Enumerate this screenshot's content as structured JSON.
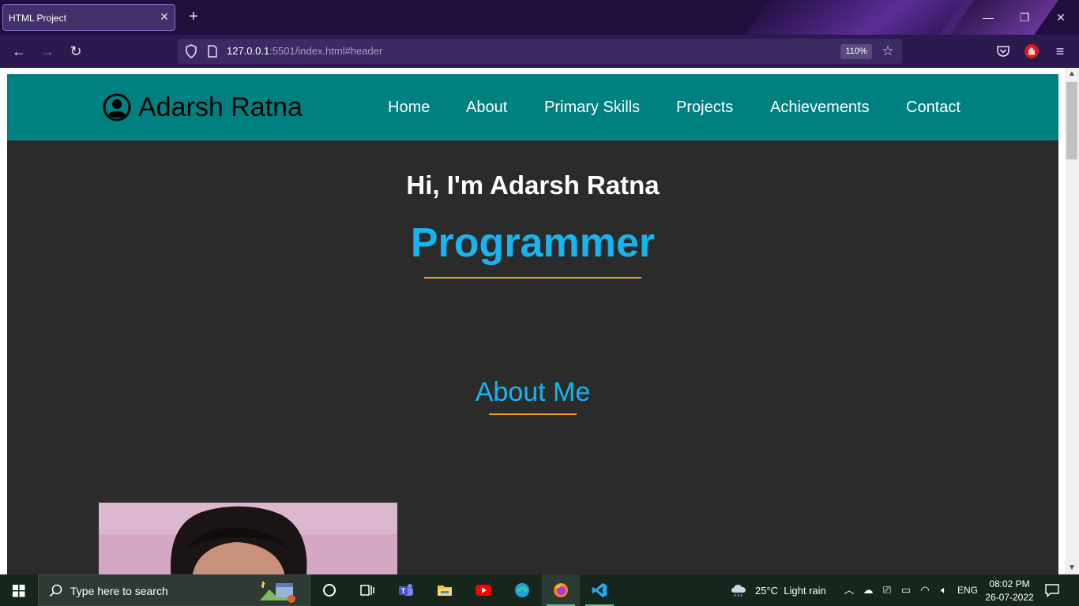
{
  "browser": {
    "tab_title": "HTML Project",
    "url_host": "127.0.0.1",
    "url_rest": ":5501/index.html#header",
    "zoom": "110%"
  },
  "site": {
    "brand": "Adarsh Ratna",
    "menu": [
      "Home",
      "About",
      "Primary Skills",
      "Projects",
      "Achievements",
      "Contact"
    ],
    "hero_greeting": "Hi, I'm Adarsh Ratna",
    "hero_role": "Programmer",
    "about_title": "About Me"
  },
  "taskbar": {
    "search_placeholder": "Type here to search",
    "weather_temp": "25°C",
    "weather_desc": "Light rain",
    "language": "ENG",
    "time": "08:02 PM",
    "date": "26-07-2022"
  },
  "colors": {
    "header_bg": "#008080",
    "page_bg": "#2b2b2b",
    "accent_blue": "#16b5ef",
    "accent_orange": "#f0a020"
  },
  "icons": [
    "shield-icon",
    "page-icon",
    "star-icon",
    "pocket-icon",
    "extension-icon",
    "menu-icon",
    "user-circle-icon",
    "windows-start-icon",
    "search-icon",
    "cortana-icon",
    "task-view-icon",
    "teams-icon",
    "file-explorer-icon",
    "youtube-icon",
    "edge-icon",
    "firefox-icon",
    "vscode-icon",
    "cloud-rain-icon",
    "notification-icon"
  ]
}
